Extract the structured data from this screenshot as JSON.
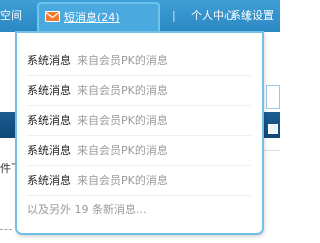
{
  "nav": {
    "left_label": "空间",
    "messages_label": "短消息(24)",
    "separator": "|",
    "profile_label": "个人中心",
    "settings_label": "系统设置"
  },
  "background": {
    "partial_text": "件下"
  },
  "dropdown": {
    "messages": [
      {
        "type": "系统消息",
        "source": "来自会员PK的消息"
      },
      {
        "type": "系统消息",
        "source": "来自会员PK的消息"
      },
      {
        "type": "系统消息",
        "source": "来自会员PK的消息"
      },
      {
        "type": "系统消息",
        "source": "来自会员PK的消息"
      },
      {
        "type": "系统消息",
        "source": "来自会员PK的消息"
      }
    ],
    "more_text": "以及另外 19 条新消息..."
  },
  "colors": {
    "nav_background": "#2b87c2",
    "active_tab": "#4aa9df",
    "dropdown_border": "#72c0e8",
    "mail_icon": "#f07a2a"
  },
  "icons": {
    "messages": "mail-icon"
  }
}
